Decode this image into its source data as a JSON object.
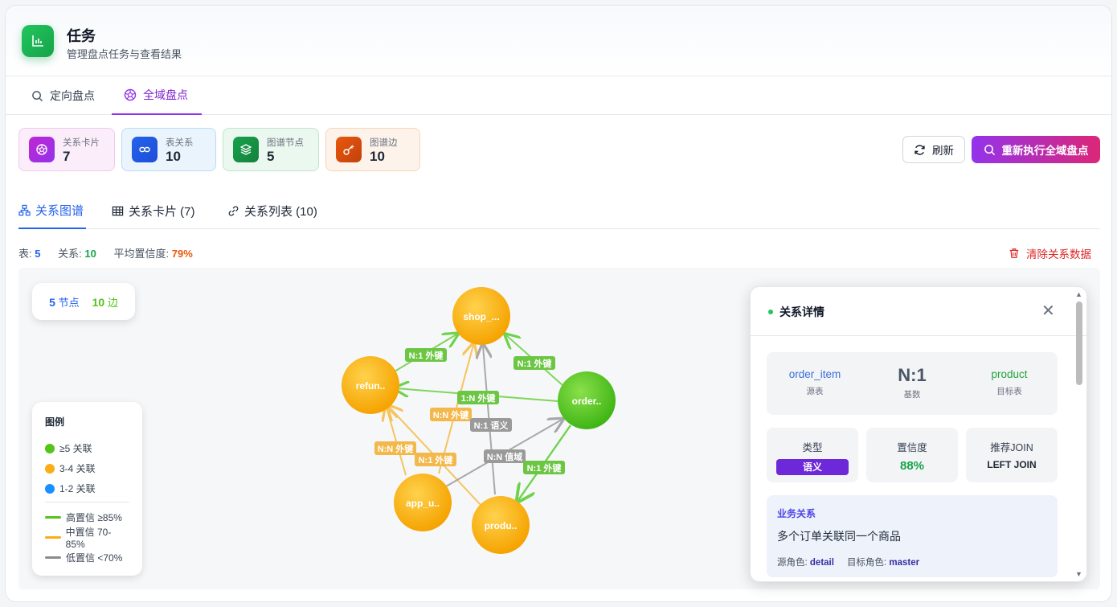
{
  "header": {
    "title": "任务",
    "subtitle": "管理盘点任务与查看结果",
    "app_icon": "bar-chart-icon"
  },
  "mode_tabs": [
    {
      "label": "定向盘点",
      "icon": "search-icon",
      "active": false
    },
    {
      "label": "全域盘点",
      "icon": "aperture-icon",
      "active": true
    }
  ],
  "stats": [
    {
      "label": "关系卡片",
      "value": "7",
      "icon": "aperture-icon",
      "color": "#c026d3"
    },
    {
      "label": "表关系",
      "value": "10",
      "icon": "link-icon",
      "color": "#2563eb"
    },
    {
      "label": "图谱节点",
      "value": "5",
      "icon": "layers-icon",
      "color": "#16a34a"
    },
    {
      "label": "图谱边",
      "value": "10",
      "icon": "key-icon",
      "color": "#ea580c"
    }
  ],
  "actions": {
    "refresh_label": "刷新",
    "rerun_label": "重新执行全域盘点"
  },
  "view_tabs": [
    {
      "label": "关系图谱",
      "icon": "graph-icon",
      "active": true
    },
    {
      "label": "关系卡片 (7)",
      "icon": "table-icon",
      "active": false
    },
    {
      "label": "关系列表 (10)",
      "icon": "link-icon",
      "active": false
    }
  ],
  "summary": {
    "tables_label": "表:",
    "tables_value": "5",
    "relations_label": "关系:",
    "relations_value": "10",
    "confidence_label": "平均置信度:",
    "confidence_value": "79%",
    "clear_label": "清除关系数据"
  },
  "graph": {
    "counter": {
      "nodes_value": "5",
      "nodes_label": "节点",
      "edges_value": "10",
      "edges_label": "边"
    },
    "nodes": [
      {
        "id": "shop",
        "label": "shop_..."
      },
      {
        "id": "refund",
        "label": "refun.."
      },
      {
        "id": "order",
        "label": "order.."
      },
      {
        "id": "app",
        "label": "app_u.."
      },
      {
        "id": "product",
        "label": "produ.."
      }
    ],
    "edges": [
      {
        "label": "N:1 外键",
        "level": "high"
      },
      {
        "label": "N:1 外键",
        "level": "high"
      },
      {
        "label": "1:N 外键",
        "level": "high"
      },
      {
        "label": "N:N 外键",
        "level": "medium"
      },
      {
        "label": "N:1 语义",
        "level": "low"
      },
      {
        "label": "N:N 外键",
        "level": "medium"
      },
      {
        "label": "N:1 外键",
        "level": "medium"
      },
      {
        "label": "N:N 值域",
        "level": "low"
      },
      {
        "label": "N:1 外键",
        "level": "high"
      }
    ],
    "legend": {
      "title": "图例",
      "dots": [
        {
          "label": "≥5 关联",
          "color": "#52c41a"
        },
        {
          "label": "3-4 关联",
          "color": "#faad14"
        },
        {
          "label": "1-2 关联",
          "color": "#1890ff"
        }
      ],
      "lines": [
        {
          "label": "高置信 ≥85%",
          "color": "#52c41a"
        },
        {
          "label": "中置信 70-85%",
          "color": "#faad14"
        },
        {
          "label": "低置信 <70%",
          "color": "#8c8c8c"
        }
      ]
    }
  },
  "detail": {
    "title": "关系详情",
    "source_table": "order_item",
    "source_label": "源表",
    "cardinality": "N:1",
    "cardinality_label": "基数",
    "target_table": "product",
    "target_label": "目标表",
    "type_label": "类型",
    "type_value": "语义",
    "confidence_label": "置信度",
    "confidence_value": "88%",
    "join_label": "推荐JOIN",
    "join_value": "LEFT JOIN",
    "business_title": "业务关系",
    "business_desc": "多个订单关联同一个商品",
    "source_role_label": "源角色:",
    "source_role": "detail",
    "target_role_label": "目标角色:",
    "target_role": "master"
  }
}
